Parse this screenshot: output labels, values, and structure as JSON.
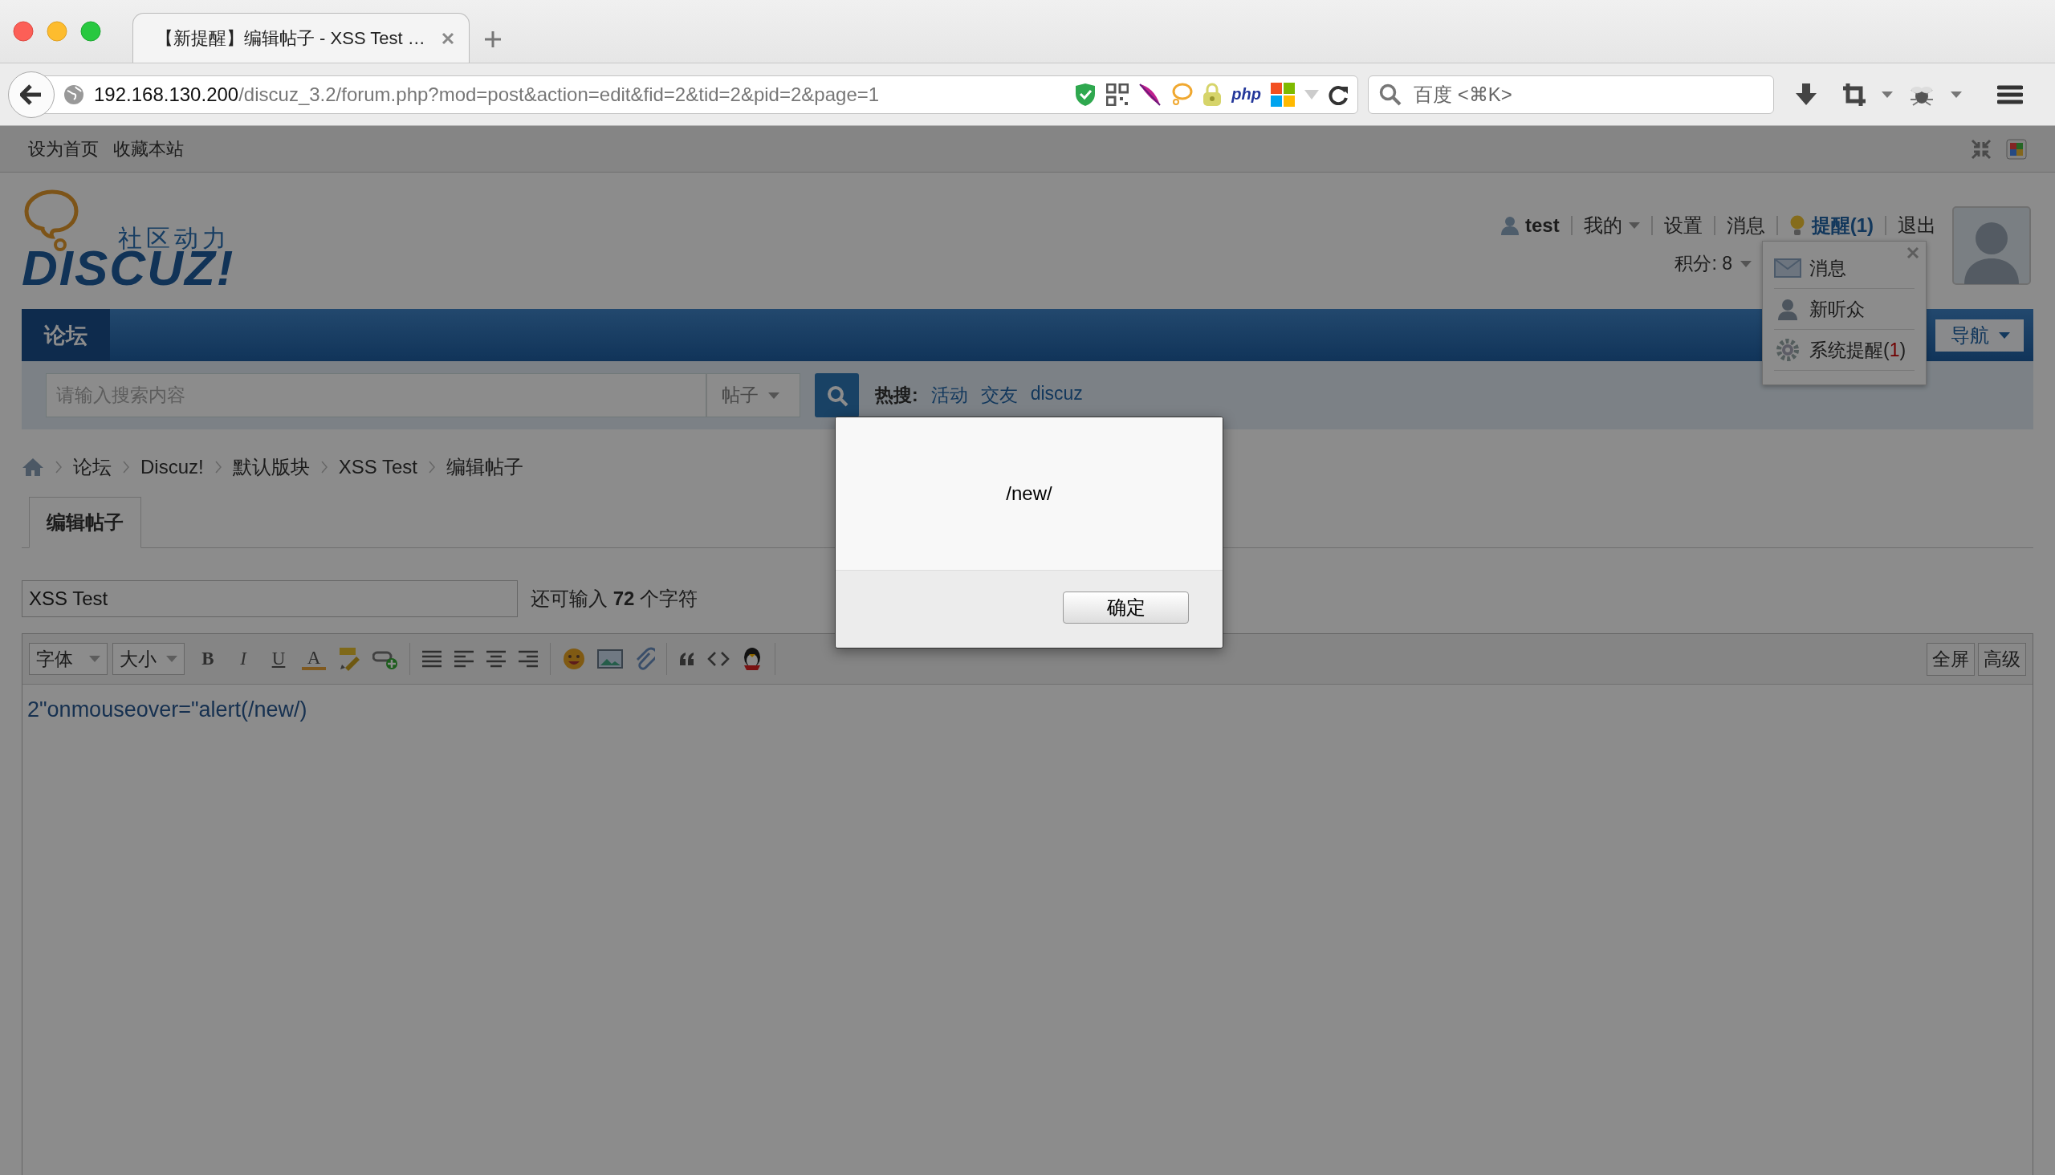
{
  "browser": {
    "tab_title": "【新提醒】编辑帖子 - XSS Test …",
    "url_host": "192.168.130.200",
    "url_path": "/discuz_3.2/forum.php?mod=post&action=edit&fid=2&tid=2&pid=2&page=1",
    "addon_label": "php",
    "search_placeholder": "百度 <⌘K>"
  },
  "top_links": [
    "设为首页",
    "收藏本站"
  ],
  "logo": {
    "tagline": "社区动力",
    "wordmark": "DISCUZ!"
  },
  "user_bar": {
    "username": "test",
    "items": [
      {
        "label": "我的",
        "kind": "link",
        "has_menu": true
      },
      {
        "label": "设置",
        "kind": "link",
        "has_menu": false
      },
      {
        "label": "消息",
        "kind": "link",
        "has_menu": false
      },
      {
        "label": "提醒(1)",
        "kind": "notice",
        "has_menu": false
      },
      {
        "label": "退出",
        "kind": "link",
        "has_menu": false
      }
    ],
    "credits": {
      "label": "积分: 8",
      "has_menu": true
    }
  },
  "notice_menu": [
    {
      "kind": "mail",
      "label": "消息"
    },
    {
      "kind": "person",
      "label": "新听众"
    },
    {
      "kind": "gear",
      "label": "系统提醒(",
      "count": "1",
      "tail": ")"
    }
  ],
  "nav": {
    "items": [
      {
        "label": "论坛",
        "selected": true
      }
    ],
    "quick_nav": "导航"
  },
  "search": {
    "placeholder": "请输入搜索内容",
    "scope": "帖子",
    "hot_label": "热搜:",
    "hot_terms": [
      "活动",
      "交友",
      "discuz"
    ]
  },
  "breadcrumb": [
    "论坛",
    "Discuz!",
    "默认版块",
    "XSS Test",
    "编辑帖子"
  ],
  "post_tab": {
    "label": "编辑帖子",
    "selected": true
  },
  "subject": {
    "value": "XSS Test",
    "remaining": "还可输入 **72** 个字符"
  },
  "editor": {
    "font_select": "字体",
    "size_select": "大小",
    "format_buttons": [
      {
        "kind": "bold",
        "label": "B"
      },
      {
        "kind": "italic",
        "label": "I"
      },
      {
        "kind": "underline",
        "label": "U"
      },
      {
        "kind": "color",
        "label": "A"
      }
    ],
    "right_buttons": [
      "全屏",
      "高级"
    ],
    "content": "2\"onmouseover=\"alert(/new/)"
  },
  "alert": {
    "dimmed": true,
    "message": "/new/",
    "button": "确定"
  }
}
